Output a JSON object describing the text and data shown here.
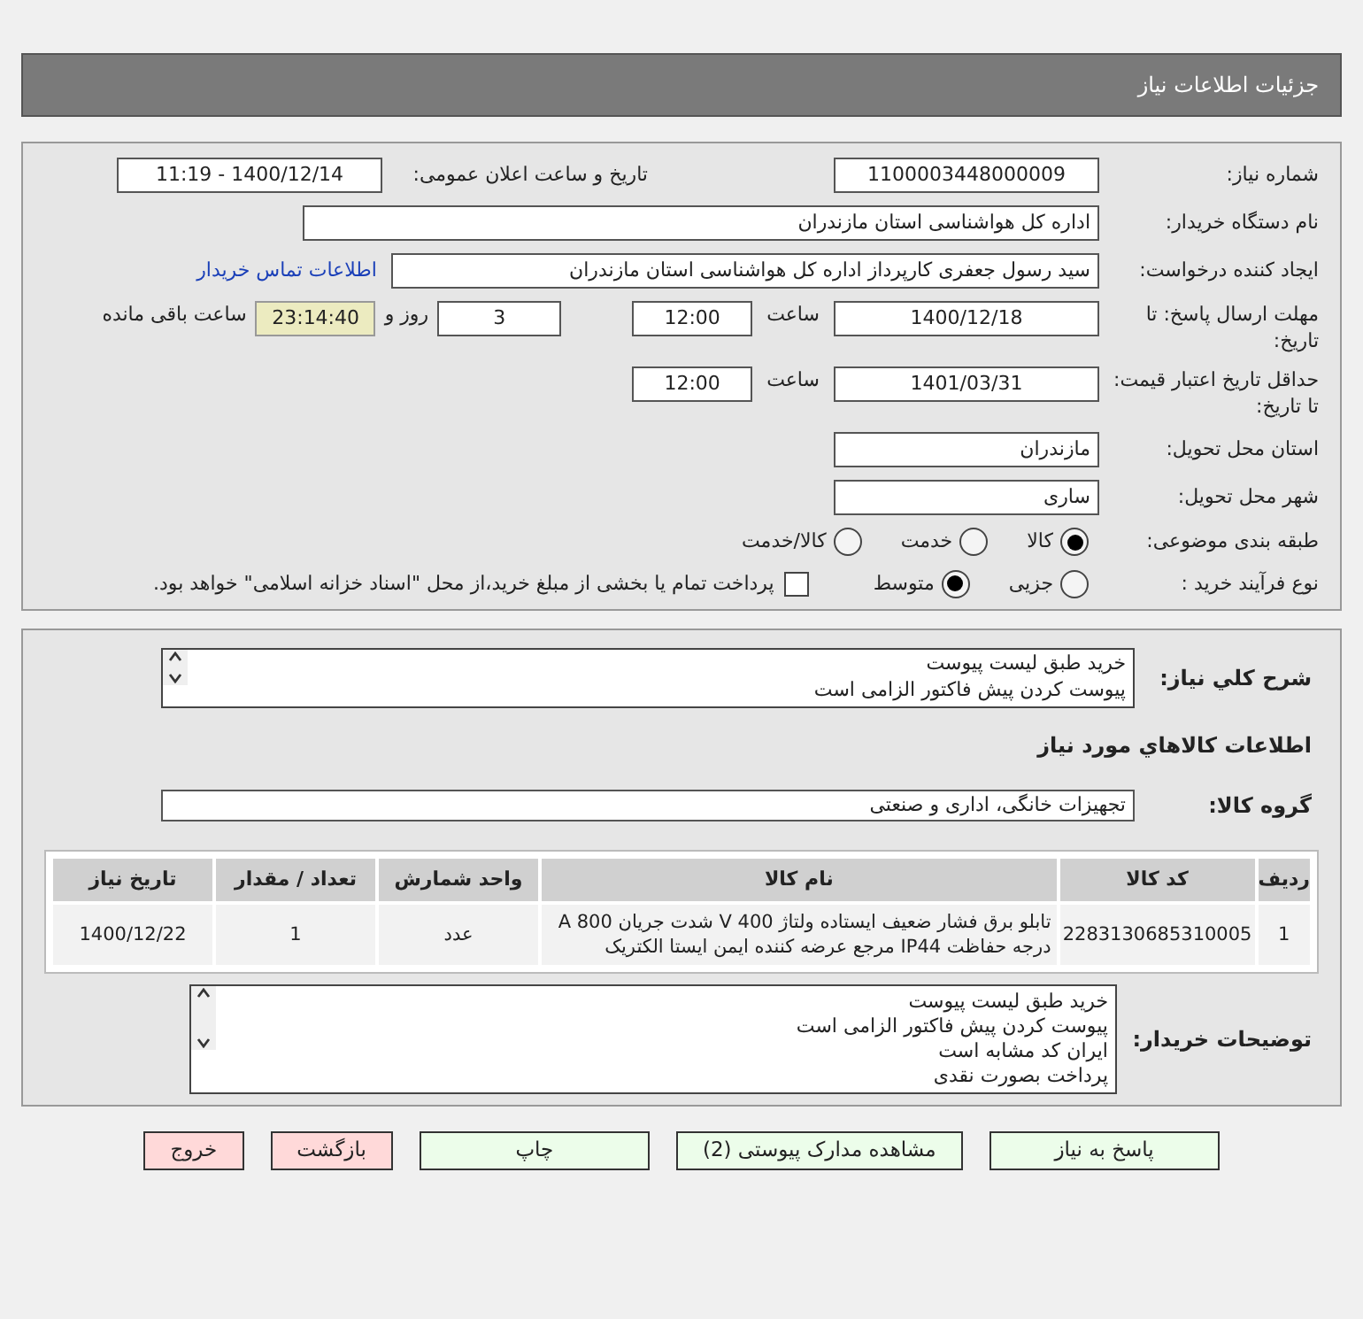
{
  "header": {
    "title": "جزئیات اطلاعات نیاز"
  },
  "need_number": {
    "label": "شماره نیاز:",
    "value": "1100003448000009"
  },
  "announce": {
    "label": "تاریخ و ساعت اعلان عمومی:",
    "value": "1400/12/14 - 11:19"
  },
  "buyer": {
    "label": "نام دستگاه خریدار:",
    "value": "اداره کل هواشناسی استان مازندران"
  },
  "creator": {
    "label": "ایجاد کننده درخواست:",
    "value": "سید رسول  جعفری کارپرداز اداره کل هواشناسی استان مازندران",
    "link": "اطلاعات تماس خریدار"
  },
  "deadline": {
    "label": "مهلت ارسال پاسخ: تا تاریخ:",
    "date": "1400/12/18",
    "time_label": "ساعت",
    "time": "12:00",
    "days": "3",
    "days_label": "روز و",
    "remaining": "23:14:40",
    "remaining_label": "ساعت باقی مانده"
  },
  "validity": {
    "label": "حداقل تاریخ اعتبار قیمت: تا تاریخ:",
    "date": "1401/03/31",
    "time_label": "ساعت",
    "time": "12:00"
  },
  "province": {
    "label": "استان محل تحویل:",
    "value": "مازندران"
  },
  "city": {
    "label": "شهر محل تحویل:",
    "value": "ساری"
  },
  "category": {
    "label": "طبقه بندی موضوعی:",
    "options": [
      {
        "label": "کالا",
        "selected": true
      },
      {
        "label": "خدمت",
        "selected": false
      },
      {
        "label": "کالا/خدمت",
        "selected": false
      }
    ]
  },
  "process": {
    "label": "نوع فرآیند خرید :",
    "options": [
      {
        "label": "جزیی",
        "selected": false
      },
      {
        "label": "متوسط",
        "selected": true
      }
    ],
    "checkbox": {
      "label": "پرداخت تمام یا بخشی از مبلغ خرید،از محل \"اسناد خزانه اسلامی\" خواهد بود.",
      "checked": false
    }
  },
  "summary": {
    "label": "شرح کلي نياز:",
    "lines": [
      "خرید طبق لیست پیوست",
      "پیوست کردن پیش فاکتور الزامی است"
    ]
  },
  "goods_title": "اطلاعات کالاهاي مورد نياز",
  "group": {
    "label": "گروه کالا:",
    "value": "تجهیزات خانگی، اداری و صنعتی"
  },
  "table": {
    "columns": [
      "ردیف",
      "کد کالا",
      "نام کالا",
      "واحد شمارش",
      "تعداد / مقدار",
      "تاریخ نیاز"
    ],
    "rows": [
      [
        "1",
        "2283130685310005",
        "تابلو برق فشار ضعیف ایستاده ولتاژ 400 V شدت جریان 800 A درجه حفاظت IP44 مرجع عرضه کننده ایمن ایستا الکتریک",
        "عدد",
        "1",
        "1400/12/22"
      ]
    ]
  },
  "buyer_notes": {
    "label": "توضیحات خریدار:",
    "lines": [
      "خرید طبق لیست پیوست",
      "پیوست کردن پیش فاکتور الزامی است",
      "ایران کد مشابه است",
      "پرداخت بصورت نقدی"
    ]
  },
  "buttons": [
    {
      "label": "پاسخ به نیاز",
      "kind": "green"
    },
    {
      "label": "مشاهده مدارک پیوستی (2)",
      "kind": "green"
    },
    {
      "label": "چاپ",
      "kind": "green"
    },
    {
      "label": "بازگشت",
      "kind": "red"
    },
    {
      "label": "خروج",
      "kind": "red"
    }
  ]
}
